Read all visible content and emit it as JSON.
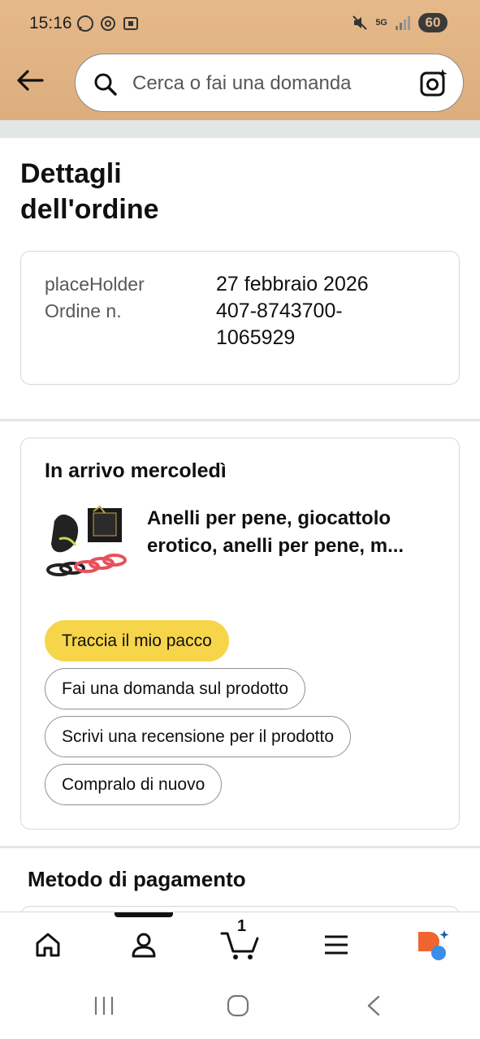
{
  "status": {
    "time": "15:16",
    "network": "5G",
    "battery": "60"
  },
  "search": {
    "placeholder": "Cerca o fai una domanda"
  },
  "page": {
    "title": "Dettagli dell'ordine"
  },
  "order": {
    "date_label": "placeHolder",
    "date_value": "27 febbraio 2026",
    "number_label": "Ordine n.",
    "number_value": "407-8743700-1065929"
  },
  "shipment": {
    "arrival": "In arrivo mercoledì",
    "product_title": "Anelli per pene, giocattolo erotico, anelli per pene, m...",
    "buttons": {
      "track": "Traccia il mio pacco",
      "ask": "Fai una domanda sul prodotto",
      "review": "Scrivi una recensione per il prodotto",
      "buy_again": "Compralo di nuovo"
    }
  },
  "payment": {
    "title": "Metodo di pagamento"
  },
  "tabbar": {
    "cart_count": "1"
  },
  "colors": {
    "header": "#e6b98a",
    "primary_button": "#f7d54b",
    "rufus_orange": "#f0652f",
    "rufus_blue": "#3a8ee6"
  },
  "icons": [
    "back-arrow-icon",
    "search-icon",
    "camera-sparkle-icon",
    "home-icon",
    "account-icon",
    "cart-icon",
    "menu-icon",
    "rufus-icon"
  ]
}
